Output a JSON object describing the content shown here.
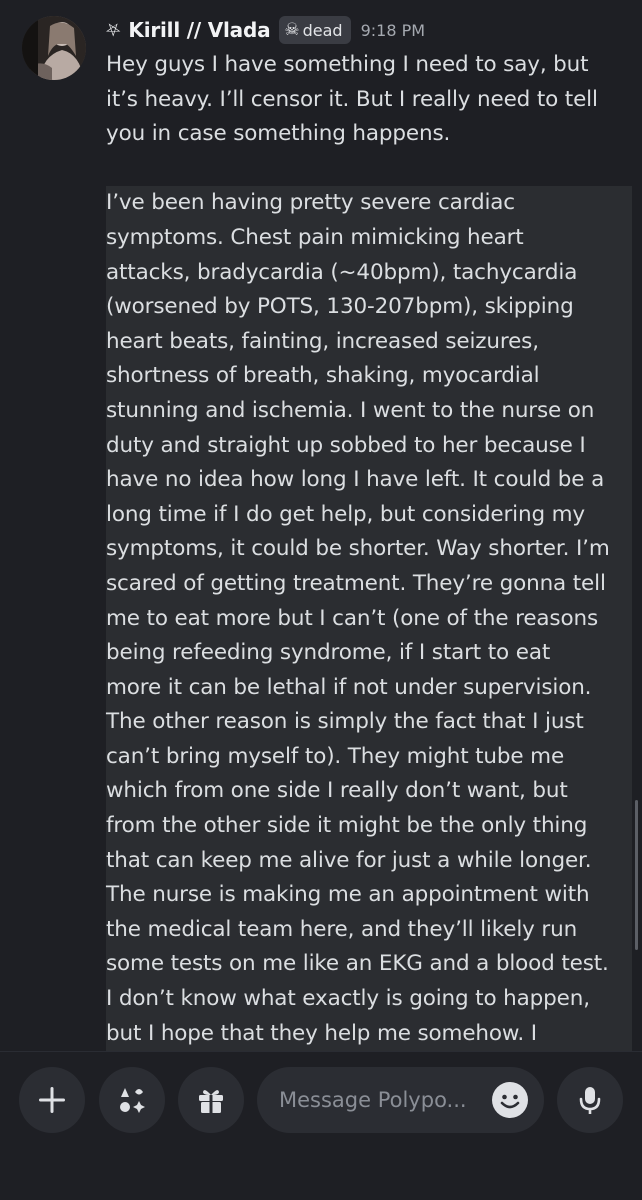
{
  "message": {
    "author_prefix_icon": "pentagram-icon",
    "author": "Kirill // Vlada",
    "tag_icon": "skull-icon",
    "tag_label": "dead",
    "timestamp": "9:18 PM",
    "paragraph1": "Hey guys I have something I need to say, but\nit’s heavy. I’ll censor it. But I really need to tell\nyou in case something happens.",
    "paragraph2": "I’ve been having pretty severe cardiac\nsymptoms. Chest pain mimicking heart\nattacks, bradycardia (~40bpm), tachycardia\n(worsened by POTS, 130-207bpm), skipping\nheart beats, fainting, increased seizures,\nshortness of breath, shaking, myocardial\nstunning and ischemia. I went to the nurse on\nduty and straight up sobbed to her because I\nhave no idea how long I have left. It could be a\nlong time if I do get help, but considering my\nsymptoms, it could be shorter. Way shorter. I’m\nscared of getting treatment. They’re gonna tell\nme to eat more but I can’t (one of the reasons\nbeing refeeding syndrome, if I start to eat\nmore it can be lethal if not under supervision.\nThe other reason is simply the fact that I just\ncan’t bring myself to). They might tube me\nwhich from one side I really don’t want, but\nfrom the other side it might be the only thing\nthat can keep me alive for just a while longer.\nThe nurse is making me an appointment with\nthe medical team here, and they’ll likely run\nsome tests on me like an EKG and a blood test.\nI don’t know what exactly is going to happen,\nbut I hope that they help me somehow. I"
  },
  "composer": {
    "add_icon": "plus-icon",
    "apps_icon": "apps-icon",
    "gift_icon": "gift-icon",
    "placeholder": "Message Polypo...",
    "emoji_icon": "emoji-icon",
    "mic_icon": "microphone-icon"
  },
  "colors": {
    "background": "#1e1f24",
    "text": "#dbdee1",
    "highlight": "#2b2d31",
    "button": "#2b2d33"
  }
}
